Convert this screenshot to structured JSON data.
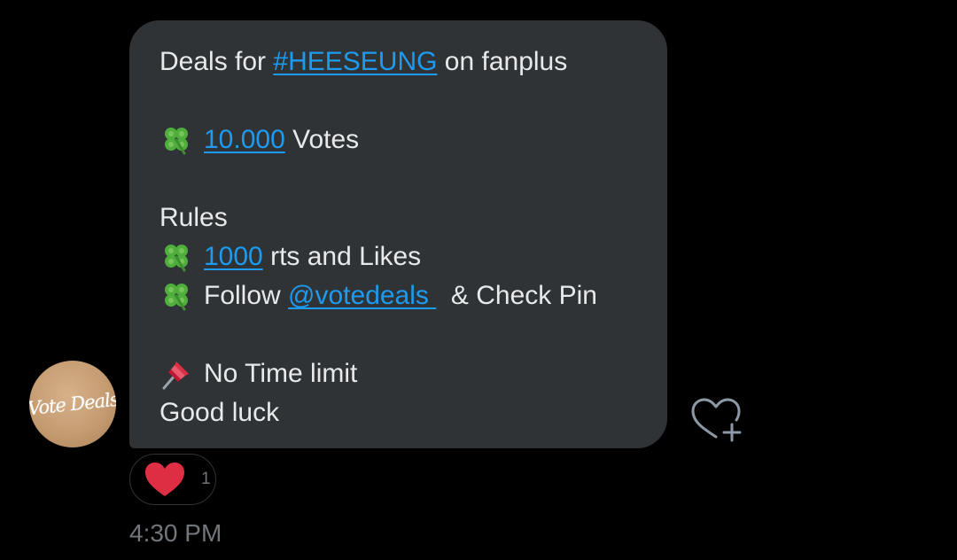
{
  "message": {
    "line1": {
      "prefix": "Deals for ",
      "hashtag": "#HEESEUNG",
      "suffix": " on fanplus"
    },
    "line2": {
      "emoji": "four-leaf-clover",
      "link": "10.000",
      "text": " Votes"
    },
    "rules_heading": "Rules",
    "rule1": {
      "emoji": "four-leaf-clover",
      "link": "1000",
      "text": " rts and Likes"
    },
    "rule2": {
      "emoji": "four-leaf-clover",
      "prefix": "Follow ",
      "mention": "@votedeals ",
      "suffix": "  & Check Pin"
    },
    "pin_line": {
      "emoji": "pushpin",
      "text": "No Time limit"
    },
    "closing": "Good luck"
  },
  "sender": {
    "avatar_text": "Vote Deals"
  },
  "reaction": {
    "emoji": "red-heart",
    "count": "1"
  },
  "timestamp": "4:30 PM",
  "icons": {
    "add_reaction": "heart-plus-icon"
  },
  "colors": {
    "background": "#000000",
    "bubble": "#2f3336",
    "text": "#e7e9ea",
    "link": "#1d9bf0",
    "muted": "#71767b",
    "heart": "#f91880",
    "clover": "#4fae3c"
  }
}
